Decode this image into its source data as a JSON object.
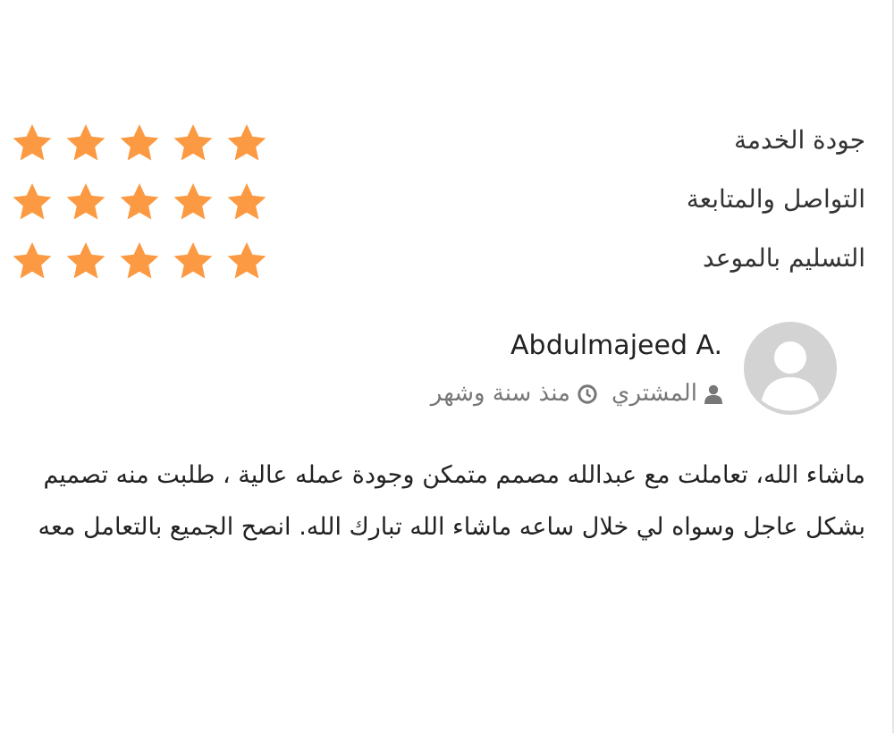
{
  "ratings": [
    {
      "label": "جودة الخدمة",
      "stars": 5
    },
    {
      "label": "التواصل والمتابعة",
      "stars": 5
    },
    {
      "label": "التسليم بالموعد",
      "stars": 5
    }
  ],
  "review": {
    "name": "Abdulmajeed A.",
    "role": "المشتري",
    "time": "منذ سنة وشهر",
    "body": "ماشاء الله، تعاملت مع عبدالله مصمم متمكن وجودة عمله عالية ، طلبت منه تصميم بشكل عاجل وسواه لي خلال ساعه ماشاء الله تبارك الله. انصح الجميع بالتعامل معه"
  }
}
